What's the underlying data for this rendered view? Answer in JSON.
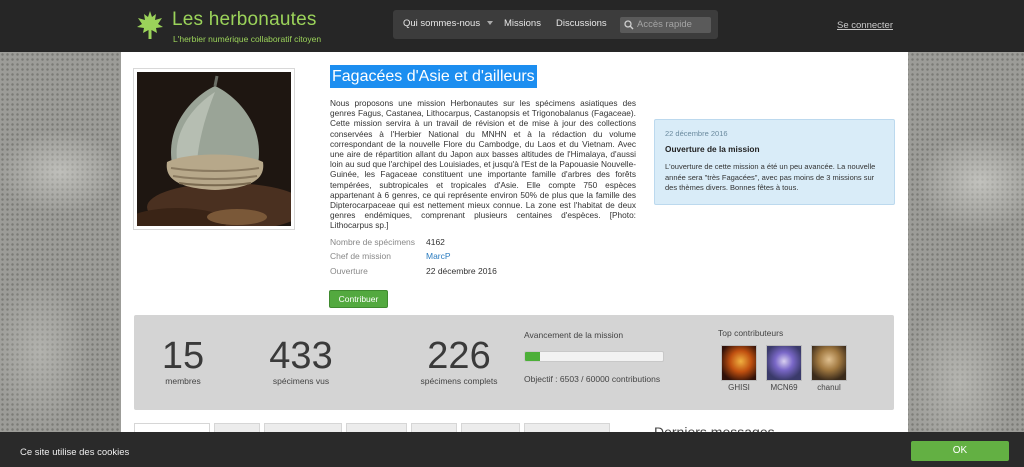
{
  "header": {
    "brand": "Les herbonautes",
    "tagline": "L'herbier numérique collaboratif citoyen",
    "nav": [
      {
        "label": "Qui sommes-nous",
        "has_dropdown": true
      },
      {
        "label": "Missions"
      },
      {
        "label": "Discussions"
      }
    ],
    "search_placeholder": "Accès rapide",
    "login": "Se connecter",
    "brand_color": "#9bd35a"
  },
  "mission": {
    "title": "Fagacées d'Asie et d'ailleurs",
    "description": "Nous proposons une mission Herbonautes sur les spécimens asiatiques des genres Fagus, Castanea, Lithocarpus, Castanopsis et Trigonobalanus (Fagaceae). Cette mission servira à un travail de révision et de mise à jour des collections conservées à l'Herbier National du MNHN et à la rédaction du volume correspondant de la nouvelle Flore du Cambodge, du Laos et du Vietnam. Avec une aire de répartition allant du Japon aux basses altitudes de l'Himalaya, d'aussi loin au sud que l'archipel des Louisiades, et jusqu'à l'Est de la Papouasie Nouvelle-Guinée, les Fagaceae constituent une importante famille d'arbres des forêts tempérées, subtropicales et tropicales d'Asie. Elle compte 750 espèces appartenant à 6 genres, ce qui représente environ 50% de plus que la famille des Dipterocarpaceae qui est nettement mieux connue. La zone est l'habitat de deux genres endémiques, comprenant plusieurs centaines d'espèces. [Photo: Lithocarpus sp.]",
    "meta": [
      {
        "key": "Nombre de spécimens",
        "value": "4162"
      },
      {
        "key": "Chef de mission",
        "value": "MarcP",
        "link": true
      },
      {
        "key": "Ouverture",
        "value": "22 décembre 2016"
      }
    ],
    "contribute_button": "Contribuer"
  },
  "news": {
    "date": "22 décembre 2016",
    "title": "Ouverture de la mission",
    "body": "L'ouverture de cette mission a été un peu avancée. La nouvelle année sera \"très Fagacées\", avec pas moins de 3 missions sur des thèmes divers. Bonnes fêtes à tous."
  },
  "stats": {
    "members": {
      "value": "15",
      "label": "membres"
    },
    "specimens_seen": {
      "value": "433",
      "label": "spécimens vus"
    },
    "specimens_complete": {
      "value": "226",
      "label": "spécimens complets"
    },
    "progress": {
      "title": "Avancement de la mission",
      "fraction": 0.108,
      "objective": "Objectif : 6503 / 60000 contributions"
    },
    "top_contributors": {
      "title": "Top contributeurs",
      "users": [
        {
          "name": "GHISI"
        },
        {
          "name": "MCN69"
        },
        {
          "name": "chanul"
        }
      ]
    }
  },
  "sidebar": {
    "latest_messages_title": "Derniers messages"
  },
  "cookie_bar": {
    "text": "Ce site utilise des cookies",
    "ok": "OK"
  }
}
